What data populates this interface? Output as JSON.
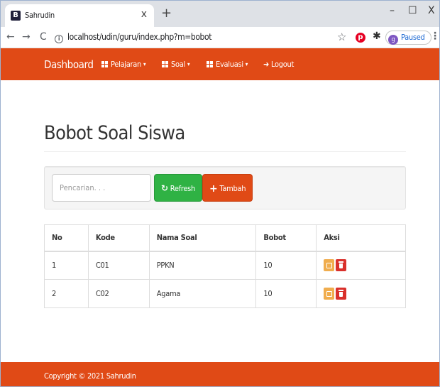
{
  "browser": {
    "tab": {
      "favicon": "B",
      "title": "Sahrudin",
      "close": "x"
    },
    "new_tab": "+",
    "window": {
      "minimize": "–",
      "maximize": "☐",
      "close": "X"
    },
    "address": {
      "back": "←",
      "forward": "→",
      "reload": "C",
      "url": "localhost/udin/guru/index.php?m=bobot",
      "star": "☆",
      "pinterest": "p",
      "extensions": "✱",
      "profile_initial": "g",
      "profile_status": "Paused",
      "menu": "⋮"
    }
  },
  "navbar": {
    "brand": "Dashboard",
    "menus": [
      {
        "label": "Pelajaran",
        "caret": "▾"
      },
      {
        "label": "Soal",
        "caret": "▾"
      },
      {
        "label": "Evaluasi",
        "caret": "▾"
      }
    ],
    "logout": {
      "icon": "➜",
      "label": "Logout"
    }
  },
  "page": {
    "title": "Bobot Soal Siswa",
    "search_placeholder": "Pencarian. . .",
    "refresh_label": "Refresh",
    "refresh_icon": "↻",
    "add_label": "Tambah",
    "add_icon": "+"
  },
  "table": {
    "headers": [
      "No",
      "Kode",
      "Nama Soal",
      "Bobot",
      "Aksi"
    ],
    "rows": [
      {
        "no": "1",
        "kode": "C01",
        "nama": "PPKN",
        "bobot": "10"
      },
      {
        "no": "2",
        "kode": "C02",
        "nama": "Agama",
        "bobot": "10"
      }
    ]
  },
  "footer": {
    "text": "Copyright © 2021 Sahrudin"
  },
  "colors": {
    "brand": "#e04a16",
    "refresh": "#2fb244",
    "edit": "#f0ad4e",
    "delete": "#d9302b"
  }
}
